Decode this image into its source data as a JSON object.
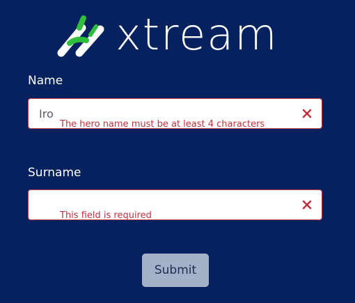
{
  "brand": {
    "logo_text": "xtream",
    "icon": "xtream-logo-icon"
  },
  "form": {
    "name": {
      "label": "Name",
      "value": "Iro",
      "error": "The hero name must be at least 4 characters",
      "clear_icon": "close-x-icon"
    },
    "surname": {
      "label": "Surname",
      "value": "",
      "error": "This field is required",
      "clear_icon": "close-x-icon"
    },
    "submit_label": "Submit"
  },
  "colors": {
    "background": "#05225f",
    "error": "#c0303c",
    "brand_green": "#2fbf3c",
    "submit_bg": "#a3b1c9"
  }
}
